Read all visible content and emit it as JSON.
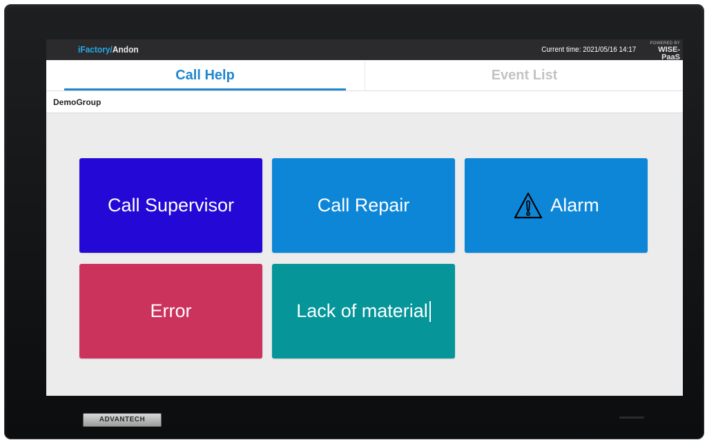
{
  "header": {
    "brand_part1": "iFactory/",
    "brand_part2": "Andon",
    "current_time": "Current time: 2021/05/16 14:17",
    "powered_by": "POWERED BY",
    "platform": "WISE-PaaS"
  },
  "tabs": [
    {
      "label": "Call Help",
      "active": true
    },
    {
      "label": "Event List",
      "active": false
    }
  ],
  "group": {
    "name": "DemoGroup"
  },
  "buttons": [
    {
      "label": "Call Supervisor",
      "color": "#2409d6"
    },
    {
      "label": "Call Repair",
      "color": "#0d86d8"
    },
    {
      "label": "Alarm",
      "color": "#0d86d8",
      "icon": "warning-triangle-icon"
    },
    {
      "label": "Error",
      "color": "#cb335d"
    },
    {
      "label": "Lack of material",
      "color": "#06969a"
    }
  ],
  "device": {
    "logo_text": "ADVANTECH"
  },
  "colors": {
    "accent": "#1f86cf",
    "topbar": "#2b2b2d",
    "background": "#ececec"
  }
}
